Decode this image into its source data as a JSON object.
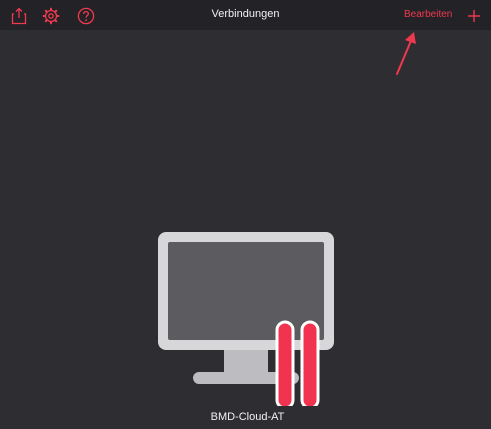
{
  "toolbar": {
    "title": "Verbindungen",
    "edit_label": "Bearbeiten",
    "share_icon": "share-icon",
    "settings_icon": "gear-icon",
    "help_icon": "help-icon",
    "add_icon": "plus-icon"
  },
  "connections": [
    {
      "name": "BMD-Cloud-AT",
      "icon": "monitor-icon"
    }
  ],
  "colors": {
    "accent": "#f0394e",
    "background": "#2e2d31",
    "topbar": "#232227",
    "monitor_frame": "#d7d6d9",
    "monitor_screen": "#5c5b60"
  }
}
